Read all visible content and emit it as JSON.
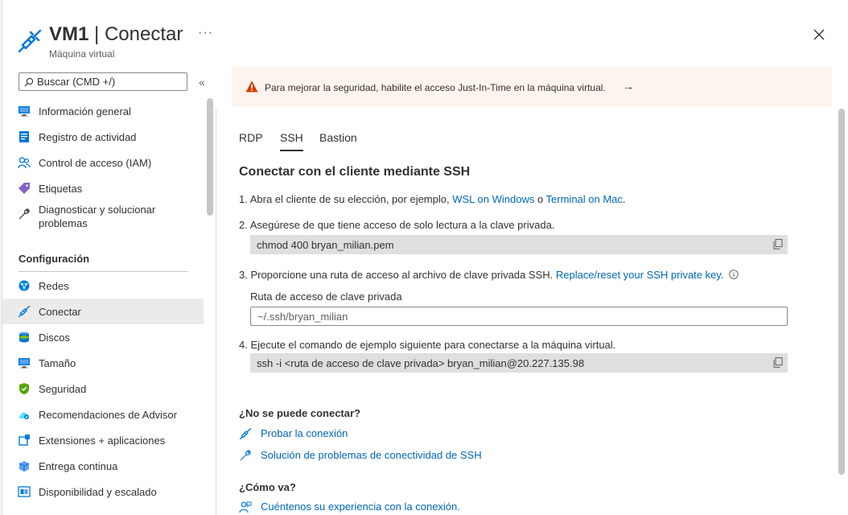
{
  "header": {
    "vm_name": "VM1",
    "separator": " | ",
    "title": "Conectar",
    "subtitle": "Máquina virtual",
    "more": "···",
    "close_icon": "close-icon"
  },
  "sidebar": {
    "search_placeholder": "Buscar (CMD +/)",
    "collapse": "«",
    "items": [
      {
        "label": "Información general",
        "icon": "monitor-icon"
      },
      {
        "label": "Registro de actividad",
        "icon": "activity-log-icon"
      },
      {
        "label": "Control de acceso (IAM)",
        "icon": "people-icon"
      },
      {
        "label": "Etiquetas",
        "icon": "tag-icon"
      },
      {
        "label": "Diagnosticar y solucionar problemas",
        "icon": "wrench-icon"
      }
    ],
    "section_title": "Configuración",
    "config_items": [
      {
        "label": "Redes",
        "icon": "network-icon"
      },
      {
        "label": "Conectar",
        "icon": "plug-icon",
        "active": true
      },
      {
        "label": "Discos",
        "icon": "disk-icon"
      },
      {
        "label": "Tamaño",
        "icon": "monitor-icon"
      },
      {
        "label": "Seguridad",
        "icon": "shield-icon"
      },
      {
        "label": "Recomendaciones de Advisor",
        "icon": "cloud-icon"
      },
      {
        "label": "Extensiones + aplicaciones",
        "icon": "extensions-icon"
      },
      {
        "label": "Entrega continua",
        "icon": "delivery-icon"
      },
      {
        "label": "Disponibilidad y escalado",
        "icon": "availability-icon"
      }
    ]
  },
  "notice": {
    "text": "Para mejorar la seguridad, habilite el acceso Just-In-Time en la máquina virtual.",
    "arrow": "→",
    "icon": "warning-icon",
    "color": "#d83b01"
  },
  "tabs": [
    {
      "label": "RDP"
    },
    {
      "label": "SSH",
      "active": true
    },
    {
      "label": "Bastion"
    }
  ],
  "content": {
    "heading": "Conectar con el cliente mediante SSH",
    "step1": {
      "prefix": "1. Abra el cliente de su elección, por ejemplo, ",
      "link1": "WSL on Windows",
      "mid": " o ",
      "link2": "Terminal on Mac",
      "suffix": "."
    },
    "step2": {
      "text": "2. Asegúrese de que tiene acceso de solo lectura a la clave privada."
    },
    "code1": "chmod 400 bryan_milian.pem",
    "step3": {
      "text": "3. Proporcione una ruta de acceso al archivo de clave privada SSH. ",
      "link": "Replace/reset your SSH private key."
    },
    "path_label": "Ruta de acceso de clave privada",
    "path_placeholder": "~/.ssh/bryan_milian",
    "step4": {
      "text": "4. Ejecute el comando de ejemplo siguiente para conectarse a la máquina virtual."
    },
    "code2": "ssh -i <ruta de acceso de clave privada> bryan_milian@20.227.135.98",
    "cant_connect": "¿No se puede conectar?",
    "test_connection": "Probar la conexión",
    "troubleshoot": "Solución de problemas de conectividad de SSH",
    "how_going": "¿Cómo va?",
    "feedback": "Cuéntenos su experiencia con la conexión."
  },
  "colors": {
    "link": "#0067b8",
    "accent": "#0078d4",
    "notice_bg": "#fdf4ee"
  }
}
